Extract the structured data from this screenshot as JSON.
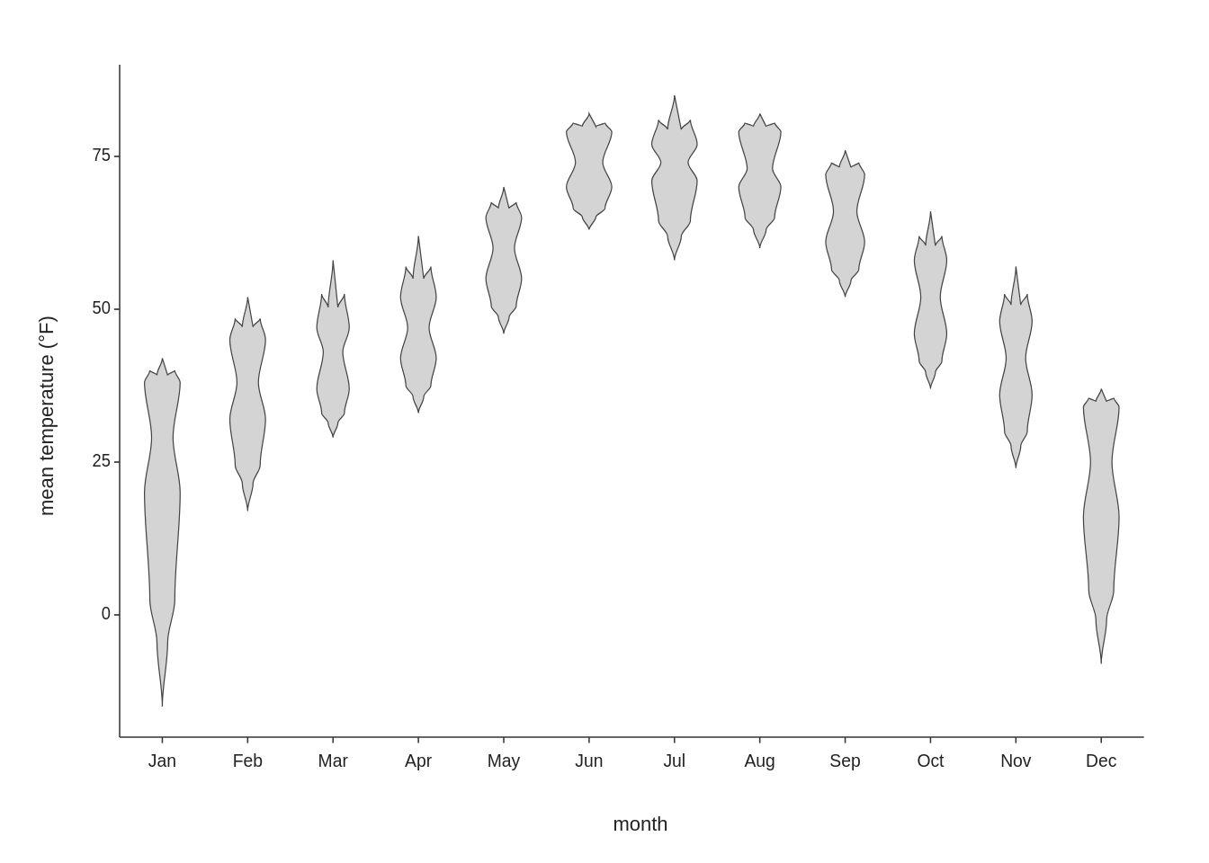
{
  "chart": {
    "title": "",
    "x_axis_label": "month",
    "y_axis_label": "mean temperature (°F)",
    "y_ticks": [
      {
        "value": 0,
        "label": "0"
      },
      {
        "value": 25,
        "label": "25"
      },
      {
        "value": 50,
        "label": "50"
      },
      {
        "value": 75,
        "label": "75"
      }
    ],
    "months": [
      "Jan",
      "Feb",
      "Mar",
      "Apr",
      "May",
      "Jun",
      "Jul",
      "Aug",
      "Sep",
      "Oct",
      "Nov",
      "Dec"
    ],
    "violins": [
      {
        "month": "Jan",
        "min": -15,
        "max": 42,
        "q1": 20,
        "q3": 38,
        "median": 29,
        "width_factor": 0.55
      },
      {
        "month": "Feb",
        "min": 17,
        "max": 52,
        "q1": 32,
        "q3": 45,
        "median": 38,
        "width_factor": 0.55
      },
      {
        "month": "Mar",
        "min": 29,
        "max": 58,
        "q1": 37,
        "q3": 47,
        "median": 43,
        "width_factor": 0.5
      },
      {
        "month": "Apr",
        "min": 33,
        "max": 62,
        "q1": 42,
        "q3": 52,
        "median": 47,
        "width_factor": 0.55
      },
      {
        "month": "May",
        "min": 46,
        "max": 70,
        "q1": 55,
        "q3": 65,
        "median": 60,
        "width_factor": 0.55
      },
      {
        "month": "Jun",
        "min": 63,
        "max": 82,
        "q1": 70,
        "q3": 79,
        "median": 74,
        "width_factor": 0.7
      },
      {
        "month": "Jul",
        "min": 58,
        "max": 85,
        "q1": 71,
        "q3": 77,
        "median": 74,
        "width_factor": 0.7
      },
      {
        "month": "Aug",
        "min": 60,
        "max": 82,
        "q1": 70,
        "q3": 79,
        "median": 73,
        "width_factor": 0.65
      },
      {
        "month": "Sep",
        "min": 52,
        "max": 76,
        "q1": 61,
        "q3": 72,
        "median": 66,
        "width_factor": 0.6
      },
      {
        "month": "Oct",
        "min": 37,
        "max": 66,
        "q1": 46,
        "q3": 58,
        "median": 52,
        "width_factor": 0.5
      },
      {
        "month": "Nov",
        "min": 24,
        "max": 57,
        "q1": 36,
        "q3": 48,
        "median": 42,
        "width_factor": 0.5
      },
      {
        "month": "Dec",
        "min": -8,
        "max": 37,
        "q1": 16,
        "q3": 34,
        "median": 25,
        "width_factor": 0.55
      }
    ]
  }
}
